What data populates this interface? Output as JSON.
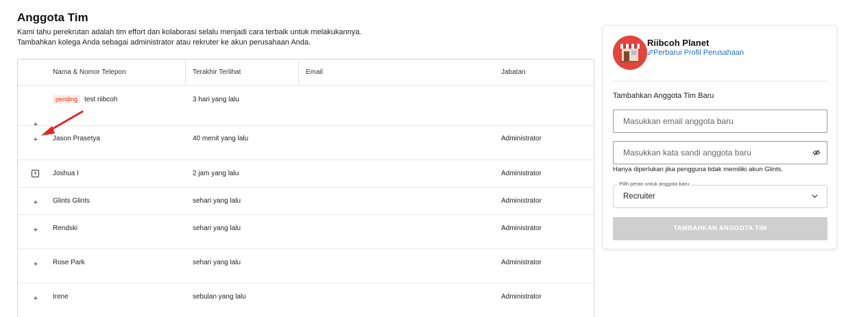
{
  "page": {
    "title": "Anggota Tim",
    "intro_line1": "Kami tahu perekrutan adalah tim effort dan kolaborasi selalu menjadi cara terbaik untuk melakukannya.",
    "intro_line2": "Tambahkan kolega Anda sebagai administrator atau rekruter ke akun perusahaan Anda."
  },
  "table": {
    "headers": {
      "name": "Nama & Nomor Telepon",
      "last_seen": "Terakhir Terlihat",
      "email": "Email",
      "role": "Jabatan"
    },
    "rows": [
      {
        "expand": "+",
        "badge": "pending",
        "name": "test riibcoh",
        "last_seen": "3 hari yang lalu",
        "email": "",
        "role": ""
      },
      {
        "expand": "+",
        "name": "Jason Prasetya",
        "last_seen": "40 menit yang lalu",
        "email": "",
        "role": "Administrator"
      },
      {
        "expand": "+",
        "name": "Joshua I",
        "last_seen": "2 jam yang lalu",
        "email": "",
        "role": "Administrator"
      },
      {
        "expand": "+",
        "name": "Glints Glints",
        "last_seen": "sehari yang lalu",
        "email": "",
        "role": "Administrator"
      },
      {
        "expand": "+",
        "name": "Rendski",
        "last_seen": "sehari yang lalu",
        "email": "",
        "role": "Administrator"
      },
      {
        "expand": "+",
        "name": "Rose Park",
        "last_seen": "sehari yang lalu",
        "email": "",
        "role": "Administrator"
      },
      {
        "expand": "+",
        "name": "Irene",
        "last_seen": "sebulan yang lalu",
        "email": "",
        "role": "Administrator"
      }
    ]
  },
  "company_card": {
    "name": "Riibcoh Planet",
    "update_link": "Perbarui Profil Perusahaan",
    "icons": {
      "logo": "storefront-icon",
      "edit": "pencil-icon",
      "eye": "eye-off-icon",
      "chevron": "chevron-down-icon"
    },
    "add_member_title": "Tambahkan Anggota Tim Baru",
    "email_placeholder": "Masukkan email anggota baru",
    "password_placeholder": "Masukkan kata sandi anggota baru",
    "hint": "Hanya diperlukan jika pengguna tidak memiliki akun Glints.",
    "role_label": "Pilih peran untuk anggota baru",
    "role_value": "Recruiter",
    "submit_label": "TAMBAHKAN ANGGOTA TIM"
  },
  "colors": {
    "accent_red": "#e5443b",
    "link_blue": "#1b74c4",
    "badge_bg": "#fde8e4",
    "badge_text": "#e0401f",
    "button_disabled": "#cfcfcf"
  }
}
